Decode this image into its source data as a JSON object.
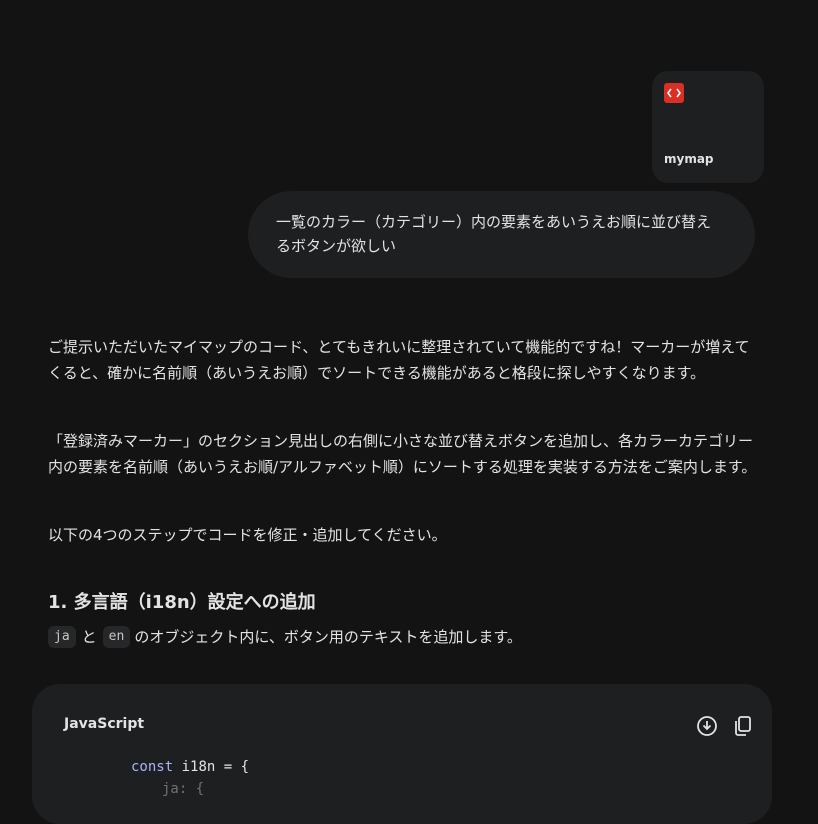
{
  "attachment": {
    "file_name": "mymap",
    "icon": "code-file-icon",
    "icon_color": "#d93025"
  },
  "user_message": {
    "text": "一覧のカラー（カテゴリー）内の要素をあいうえお順に並び替えるボタンが欲しい"
  },
  "response": {
    "paragraph1": "ご提示いただいたマイマップのコード、とてもきれいに整理されていて機能的ですね！マーカーが増えてくると、確かに名前順（あいうえお順）でソートできる機能があると格段に探しやすくなります。",
    "paragraph2": "「登録済みマーカー」のセクション見出しの右側に小さな並び替えボタンを追加し、各カラーカテゴリー内の要素を名前順（あいうえお順/アルファベット順）にソートする処理を実装する方法をご案内します。",
    "paragraph3": "以下の4つのステップでコードを修正・追加してください。",
    "heading1": "1. 多言語（i18n）設定への追加",
    "step1": {
      "code_ja": "ja",
      "connector": "と",
      "code_en": "en",
      "rest": "のオブジェクト内に、ボタン用のテキストを追加します。"
    }
  },
  "code_block": {
    "language": "JavaScript",
    "line1_keyword": "const",
    "line1_rest": " i18n = {",
    "line2": "ja: {",
    "download_icon": "download-icon",
    "copy_icon": "copy-icon"
  }
}
